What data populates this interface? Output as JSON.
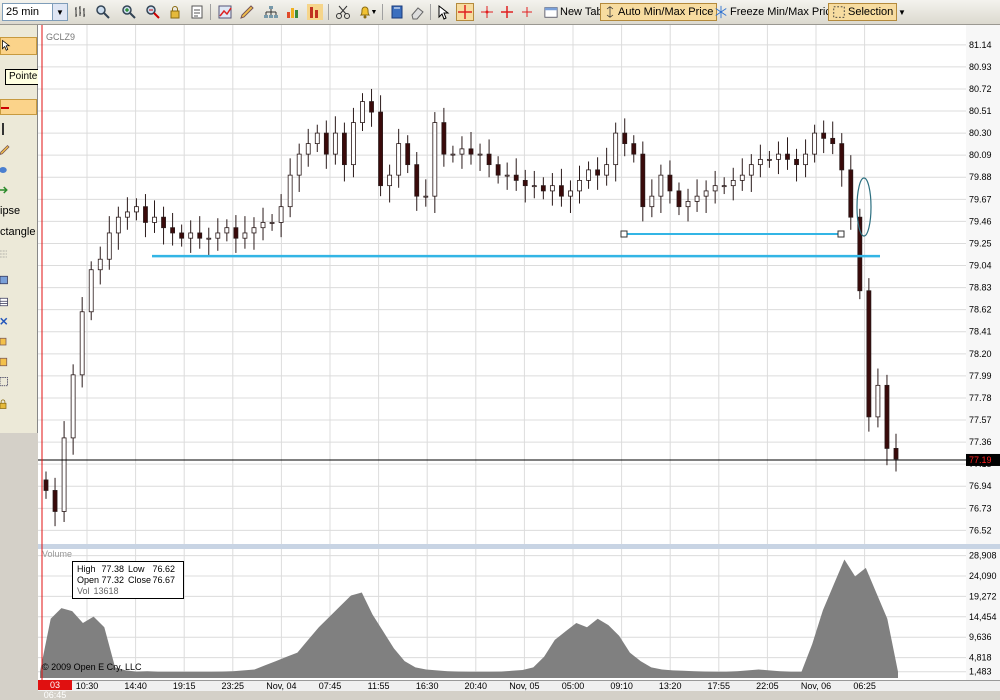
{
  "toolbar": {
    "interval": "25 min",
    "new_tab": "New Tab",
    "auto_minmax": "Auto Min/Max Price",
    "freeze_minmax": "Freeze Min/Max Price",
    "selection": "Selection"
  },
  "left_panel": {
    "tooltip": "Pointer",
    "items": [
      "ipse",
      "ctangle"
    ]
  },
  "chart": {
    "symbol": "GCLZ9",
    "current_price": "77.19",
    "price_labels": [
      "81.14",
      "80.93",
      "80.72",
      "80.51",
      "80.30",
      "80.09",
      "79.88",
      "79.67",
      "79.46",
      "79.25",
      "79.04",
      "78.83",
      "78.62",
      "78.41",
      "78.20",
      "77.99",
      "77.78",
      "77.57",
      "77.36",
      "77.15",
      "76.94",
      "76.73",
      "76.52"
    ],
    "volume_label": "Volume",
    "volume_labels": [
      "28,908",
      "24,090",
      "19,272",
      "14,454",
      "9,636",
      "4,818",
      "1,483"
    ],
    "time_start": "03 06:45",
    "time_labels": [
      "10:30",
      "14:40",
      "19:15",
      "23:25",
      "Nov, 04",
      "07:45",
      "11:55",
      "16:30",
      "20:40",
      "Nov, 05",
      "05:00",
      "09:10",
      "13:20",
      "17:55",
      "22:05",
      "Nov, 06",
      "06:25"
    ],
    "copyright": "© 2009 Open E Cry, LLC"
  },
  "info": {
    "high_label": "High",
    "high": "77.38",
    "low_label": "Low",
    "low": "76.62",
    "open_label": "Open",
    "open": "77.32",
    "close_label": "Close",
    "close": "76.67",
    "vol_label": "Vol",
    "vol": "13618"
  },
  "colors": {
    "grid": "#dcdcdc",
    "candle": "#2a1a1a",
    "trendline": "#33b5e5",
    "volume": "#808080",
    "price_marker": "#000000",
    "price_text": "#ff2020"
  },
  "chart_data": {
    "type": "candlestick",
    "symbol": "GCLZ9",
    "interval": "25 min",
    "close": [
      76.9,
      76.7,
      77.4,
      78.0,
      78.6,
      79.0,
      79.1,
      79.35,
      79.5,
      79.55,
      79.6,
      79.45,
      79.5,
      79.4,
      79.35,
      79.3,
      79.35,
      79.3,
      79.3,
      79.35,
      79.4,
      79.3,
      79.35,
      79.4,
      79.45,
      79.45,
      79.6,
      79.9,
      80.1,
      80.2,
      80.3,
      80.1,
      80.3,
      80.0,
      80.4,
      80.6,
      80.5,
      79.8,
      79.9,
      80.2,
      80.0,
      79.7,
      79.7,
      80.4,
      80.1,
      80.1,
      80.15,
      80.1,
      80.1,
      80.0,
      79.9,
      79.9,
      79.85,
      79.8,
      79.8,
      79.75,
      79.8,
      79.7,
      79.75,
      79.85,
      79.95,
      79.9,
      80.0,
      80.3,
      80.2,
      80.1,
      79.6,
      79.7,
      79.9,
      79.75,
      79.6,
      79.65,
      79.7,
      79.75,
      79.8,
      79.8,
      79.85,
      79.9,
      80.0,
      80.05,
      80.05,
      80.1,
      80.05,
      80.0,
      80.1,
      80.3,
      80.25,
      80.2,
      79.95,
      79.5,
      78.8,
      77.6,
      77.9,
      77.3,
      77.2
    ],
    "volume": [
      1483,
      14000,
      16500,
      15800,
      13000,
      14500,
      12000,
      2500,
      1800,
      1500,
      1600,
      1483,
      1483,
      1483,
      1483,
      1483,
      1483,
      1500,
      1600,
      1800,
      2000,
      3000,
      4000,
      5000,
      6000,
      9000,
      12000,
      14500,
      17000,
      19500,
      20200,
      15000,
      11000,
      7000,
      4000,
      2500,
      2000,
      1800,
      1600,
      1500,
      1483,
      1483,
      1483,
      1500,
      1700,
      1900,
      2500,
      5000,
      9000,
      11000,
      13000,
      12000,
      14000,
      12500,
      10000,
      6000,
      4000,
      2500,
      2000,
      1800,
      1700,
      1600,
      1500,
      1483,
      1483,
      1600,
      1800,
      2000,
      1800,
      1600,
      1483,
      1483,
      8000,
      16000,
      22000,
      28000,
      24000,
      26000,
      20000,
      14000,
      1483
    ],
    "trendlines": [
      {
        "from": [
          79.13
        ],
        "to": [
          79.13
        ]
      },
      {
        "from": [
          79.34
        ],
        "to": [
          79.34
        ]
      }
    ],
    "ylim": [
      76.4,
      81.3
    ],
    "volume_ylim": [
      0,
      30000
    ]
  }
}
